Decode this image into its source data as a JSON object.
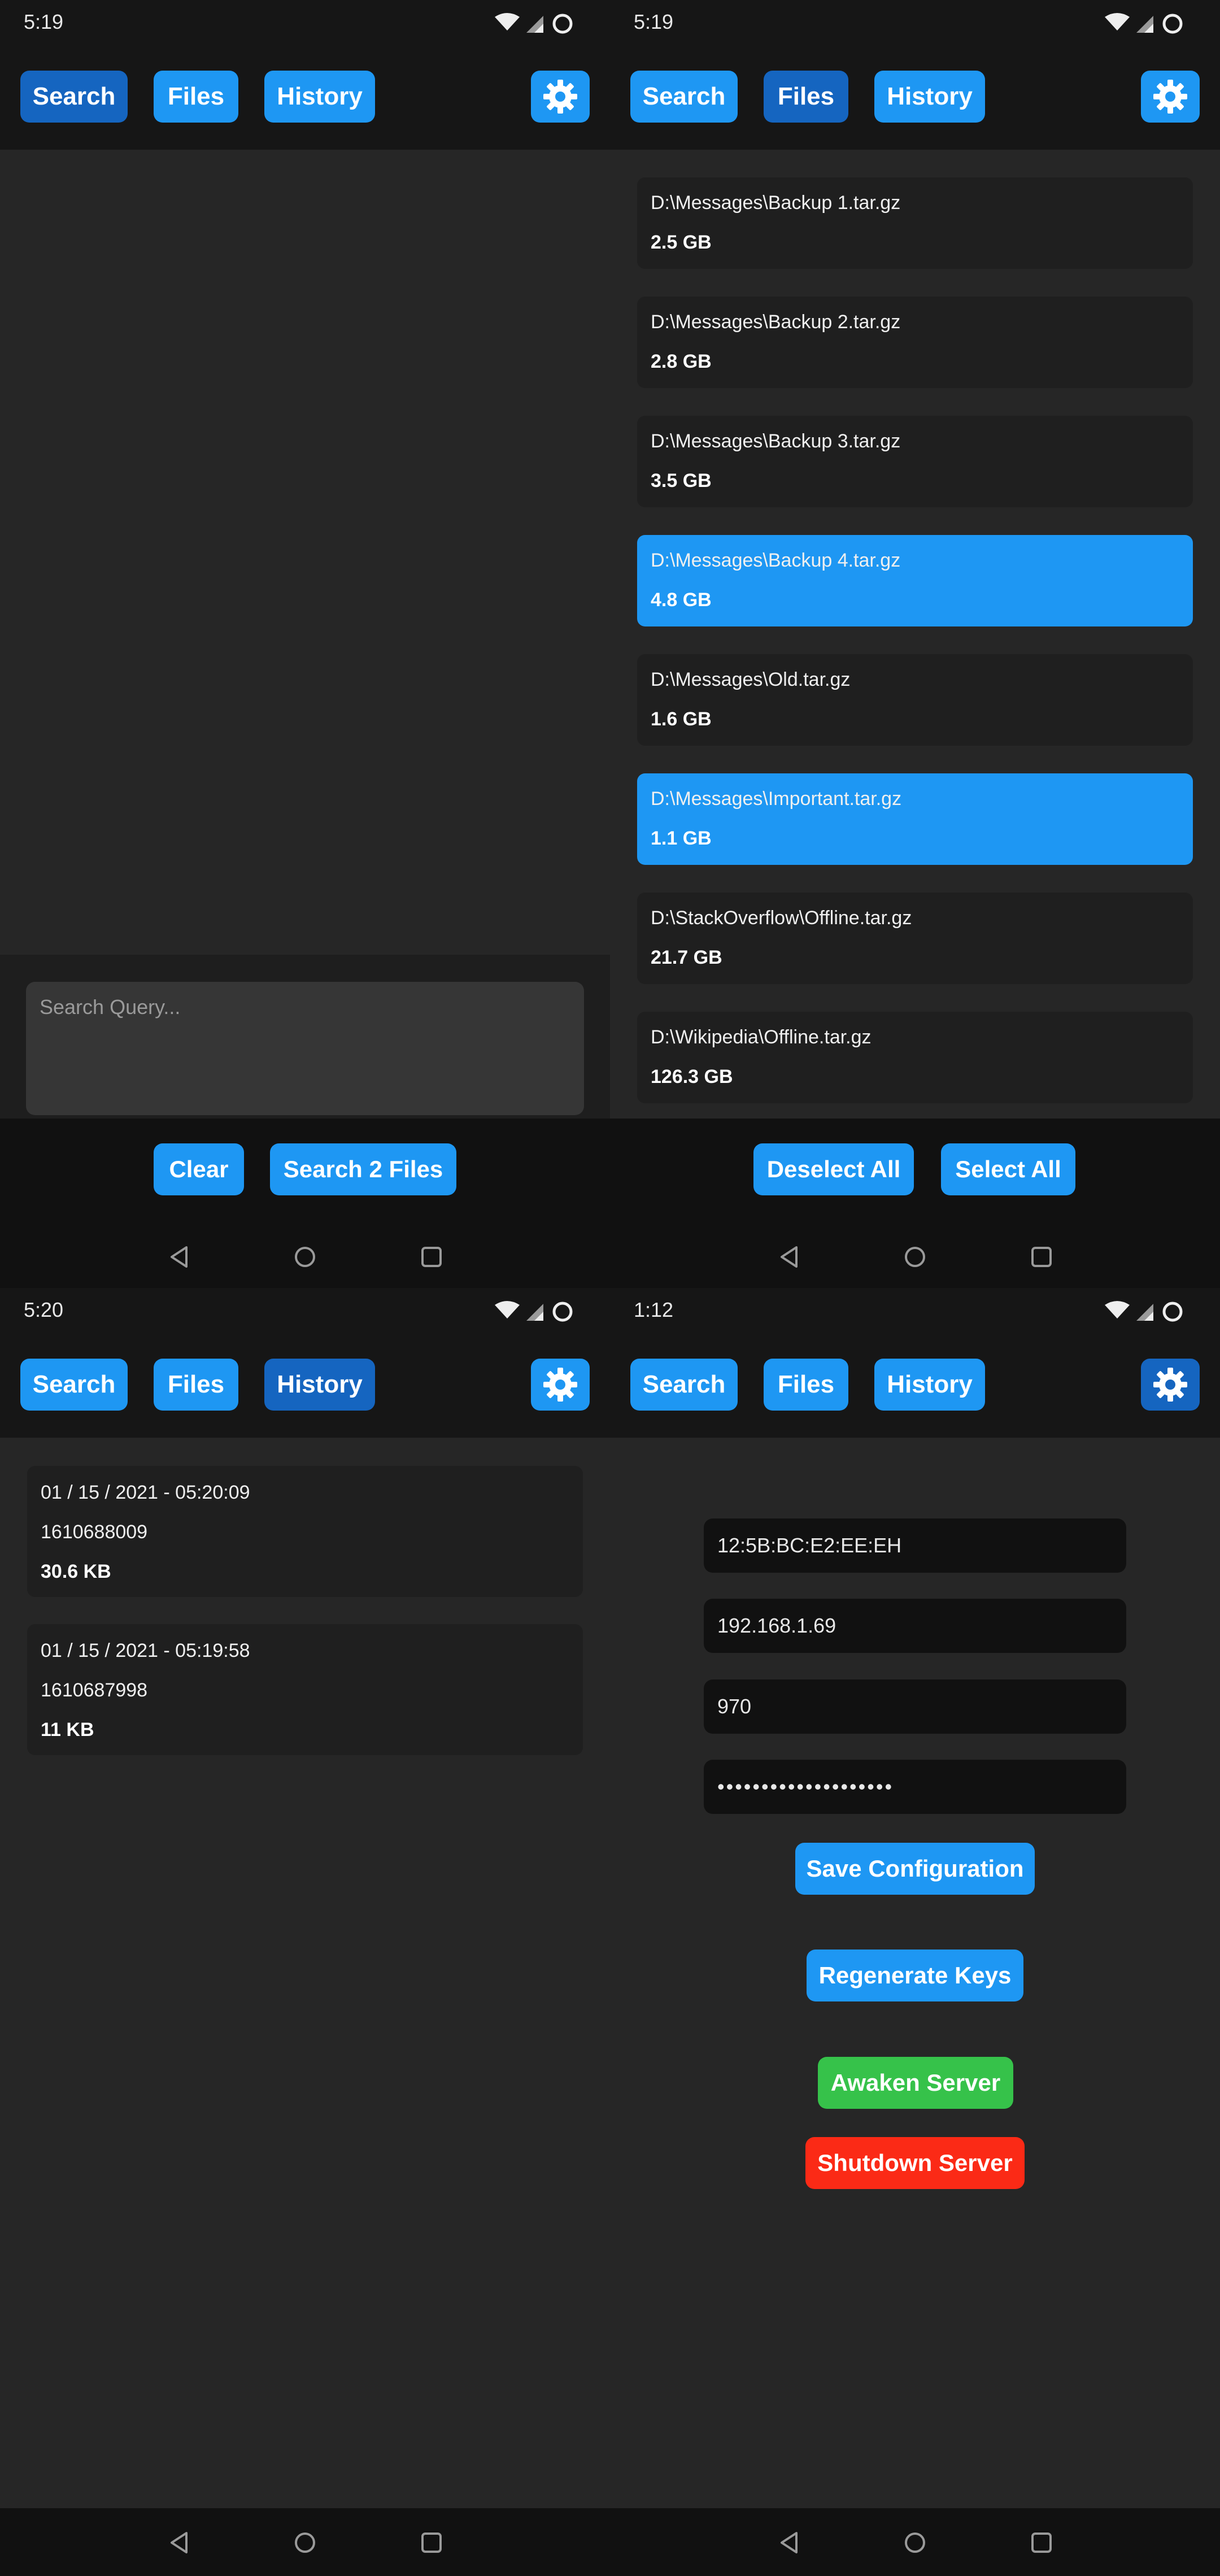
{
  "nav": {
    "search": "Search",
    "files": "Files",
    "history": "History"
  },
  "colors": {
    "accent": "#1e97f3",
    "accent_active": "#1565c0",
    "green": "#36c24a",
    "red": "#fb2a16"
  },
  "panel_search": {
    "time": "5:19",
    "active_tab": "Search",
    "query_placeholder": "Search Query...",
    "clear_label": "Clear",
    "search_label": "Search 2 Files"
  },
  "panel_files": {
    "time": "5:19",
    "active_tab": "Files",
    "files": [
      {
        "path": "D:\\Messages\\Backup 1.tar.gz",
        "size": "2.5 GB",
        "selected": false
      },
      {
        "path": "D:\\Messages\\Backup 2.tar.gz",
        "size": "2.8 GB",
        "selected": false
      },
      {
        "path": "D:\\Messages\\Backup 3.tar.gz",
        "size": "3.5 GB",
        "selected": false
      },
      {
        "path": "D:\\Messages\\Backup 4.tar.gz",
        "size": "4.8 GB",
        "selected": true
      },
      {
        "path": "D:\\Messages\\Old.tar.gz",
        "size": "1.6 GB",
        "selected": false
      },
      {
        "path": "D:\\Messages\\Important.tar.gz",
        "size": "1.1 GB",
        "selected": true
      },
      {
        "path": "D:\\StackOverflow\\Offline.tar.gz",
        "size": "21.7 GB",
        "selected": false
      },
      {
        "path": "D:\\Wikipedia\\Offline.tar.gz",
        "size": "126.3 GB",
        "selected": false
      }
    ],
    "deselect_label": "Deselect All",
    "select_label": "Select All"
  },
  "panel_history": {
    "time": "5:20",
    "active_tab": "History",
    "entries": [
      {
        "date": "01 / 15 / 2021 - 05:20:09",
        "id": "1610688009",
        "size": "30.6 KB"
      },
      {
        "date": "01 / 15 / 2021 - 05:19:58",
        "id": "1610687998",
        "size": "11 KB"
      }
    ]
  },
  "panel_settings": {
    "time": "1:12",
    "active_tab": "Settings",
    "mac": "12:5B:BC:E2:EE:EH",
    "ip": "192.168.1.69",
    "port": "970",
    "password_mask": "••••••••••••••••••••",
    "save_label": "Save Configuration",
    "regen_label": "Regenerate Keys",
    "awaken_label": "Awaken Server",
    "shutdown_label": "Shutdown Server"
  }
}
